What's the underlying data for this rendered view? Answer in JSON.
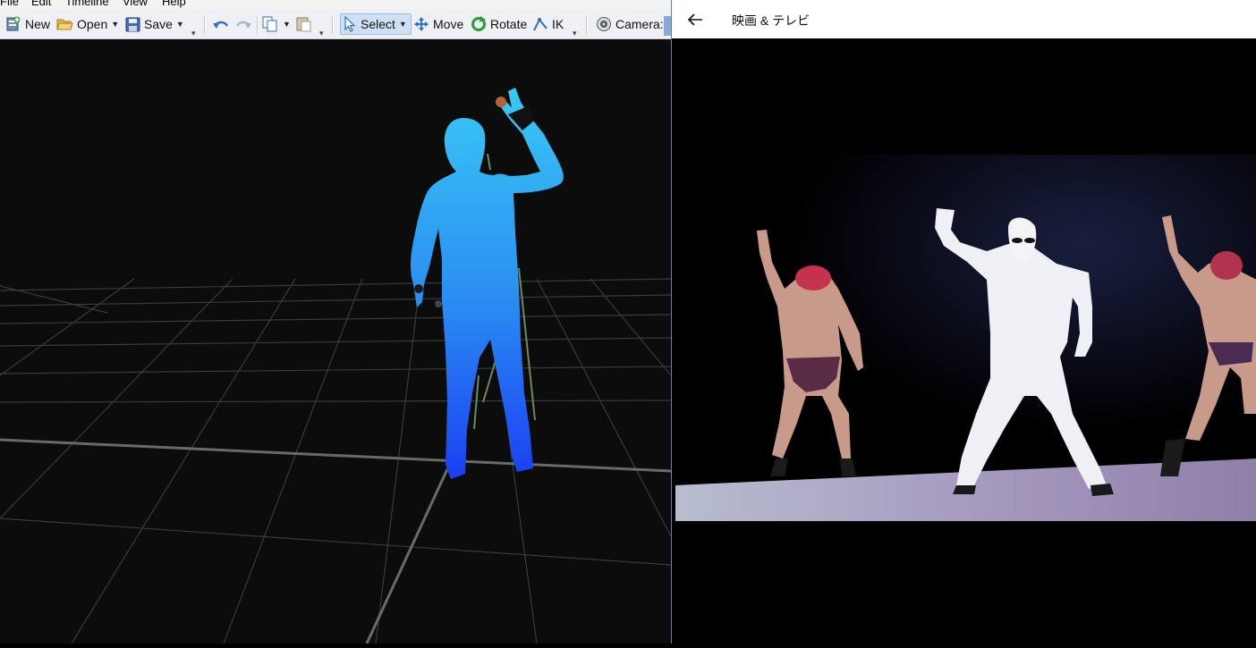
{
  "left_app": {
    "menu": [
      "File",
      "Edit",
      "Timeline",
      "View",
      "Help"
    ],
    "toolbar": {
      "new": "New",
      "open": "Open",
      "save": "Save",
      "select": "Select",
      "move": "Move",
      "rotate": "Rotate",
      "ik": "IK",
      "camera": "Camera:"
    }
  },
  "right_app": {
    "title": "映画 & テレビ",
    "back": "←"
  },
  "colors": {
    "toolbar_bg": "#eef0f3",
    "viewport_bg": "#0c0c0c",
    "figure_top": "#39c9f4",
    "figure_bottom": "#1a3ff2",
    "select_active": "#cfe0f5"
  }
}
